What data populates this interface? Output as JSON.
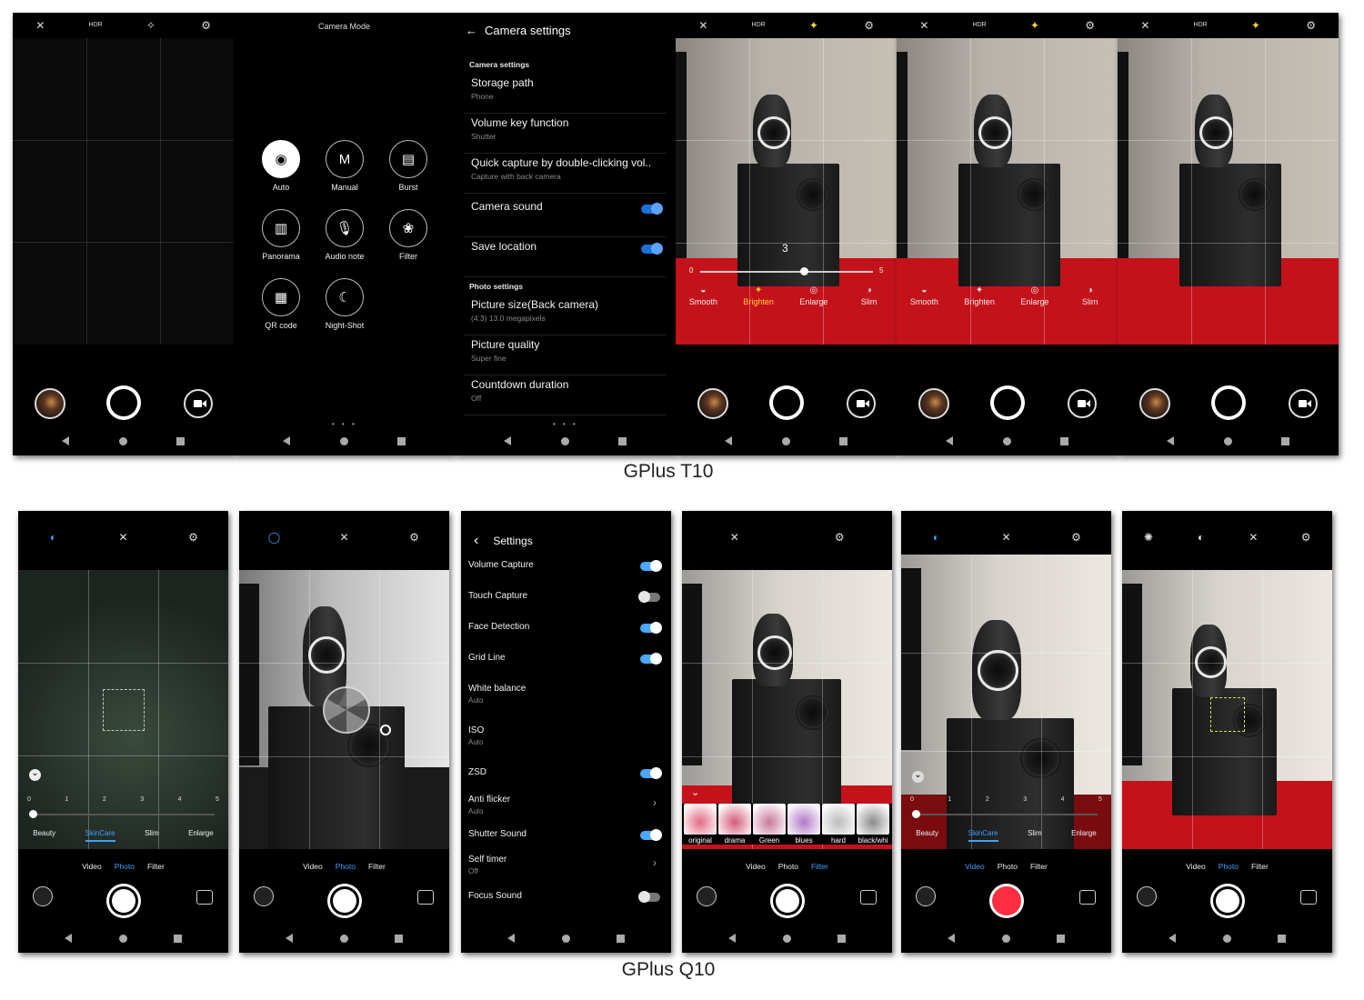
{
  "captions": {
    "top": "GPlus T10",
    "bottom": "GPlus Q10"
  },
  "t10": {
    "topbar_icons": [
      "flash-off-icon",
      "hdr-off-icon",
      "beauty-off-icon",
      "settings-camera-icon"
    ],
    "hdr_label": "HDR OFF",
    "mode_screen": {
      "title": "Camera Mode",
      "modes": [
        {
          "label": "Auto",
          "icon": "camera-icon",
          "glyph": "◉",
          "selected": true
        },
        {
          "label": "Manual",
          "icon": "manual-icon",
          "glyph": "M",
          "selected": false
        },
        {
          "label": "Burst",
          "icon": "burst-icon",
          "glyph": "▤",
          "selected": false
        },
        {
          "label": "Panorama",
          "icon": "panorama-icon",
          "glyph": "▥",
          "selected": false
        },
        {
          "label": "Audio note",
          "icon": "microphone-icon",
          "glyph": "🎙",
          "selected": false
        },
        {
          "label": "Filter",
          "icon": "filter-icon",
          "glyph": "❀",
          "selected": false
        },
        {
          "label": "QR code",
          "icon": "qr-code-icon",
          "glyph": "▦",
          "selected": false
        },
        {
          "label": "Night-Shot",
          "icon": "moon-icon",
          "glyph": "☾",
          "selected": false
        }
      ]
    },
    "settings_screen": {
      "title": "Camera settings",
      "section_camera": "Camera settings",
      "section_photo": "Photo settings",
      "items": [
        {
          "title": "Storage path",
          "sub": "Phone"
        },
        {
          "title": "Volume key function",
          "sub": "Shutter"
        },
        {
          "title": "Quick capture by double-clicking vol..",
          "sub": "Capture with back camera"
        },
        {
          "title": "Camera sound",
          "toggle": true
        },
        {
          "title": "Save location",
          "toggle": true
        },
        {
          "title": "Picture size(Back camera)",
          "sub": "(4:3) 13.0 megapixels"
        },
        {
          "title": "Picture quality",
          "sub": "Super fine"
        },
        {
          "title": "Countdown duration",
          "sub": "Off"
        }
      ]
    },
    "beauty": {
      "value_label": "3",
      "min_label": "0",
      "max_label": "5",
      "value": 3,
      "max": 5,
      "options": [
        {
          "label": "Smooth",
          "glyph": "◒"
        },
        {
          "label": "Brighten",
          "glyph": "✦"
        },
        {
          "label": "Enlarge",
          "glyph": "◎"
        },
        {
          "label": "Slim",
          "glyph": "◑"
        }
      ],
      "selected_color": "#ffd43a"
    },
    "accent": "#1e6fd6"
  },
  "q10": {
    "topbar_icons": [
      "skincare-icon",
      "flash-off-icon",
      "settings-gear-icon"
    ],
    "tabs": [
      "Video",
      "Photo",
      "Filter"
    ],
    "beauty": {
      "ticks": [
        "0",
        "1",
        "2",
        "3",
        "4",
        "5"
      ],
      "value": 0,
      "options": [
        "Beauty",
        "SkinCare",
        "Slim",
        "Enlarge"
      ],
      "selected": "SkinCare"
    },
    "settings_screen": {
      "title": "Settings",
      "items": [
        {
          "title": "Volume Capture",
          "toggle": "on"
        },
        {
          "title": "Touch Capture",
          "toggle": "off"
        },
        {
          "title": "Face Detection",
          "toggle": "on"
        },
        {
          "title": "Grid Line",
          "toggle": "on"
        },
        {
          "title": "White balance",
          "sub": "Auto"
        },
        {
          "title": "ISO",
          "sub": "Auto"
        },
        {
          "title": "ZSD",
          "toggle": "on"
        },
        {
          "title": "Anti flicker",
          "sub": "Auto",
          "chevron": true
        },
        {
          "title": "Shutter Sound",
          "toggle": "on"
        },
        {
          "title": "Self timer",
          "sub": "Off",
          "chevron": true
        },
        {
          "title": "Focus Sound",
          "toggle": "off"
        }
      ]
    },
    "filters": [
      {
        "label": "original",
        "color": "#e36b86"
      },
      {
        "label": "drama",
        "color": "#d65a7a"
      },
      {
        "label": "Green",
        "color": "#c9789a"
      },
      {
        "label": "blues",
        "color": "#b279c9"
      },
      {
        "label": "hard",
        "color": "#bdbdbd"
      },
      {
        "label": "black/whi",
        "color": "#8c8c8c"
      }
    ],
    "accent": "#3fa2ff",
    "record_color": "#ff2d3f"
  }
}
